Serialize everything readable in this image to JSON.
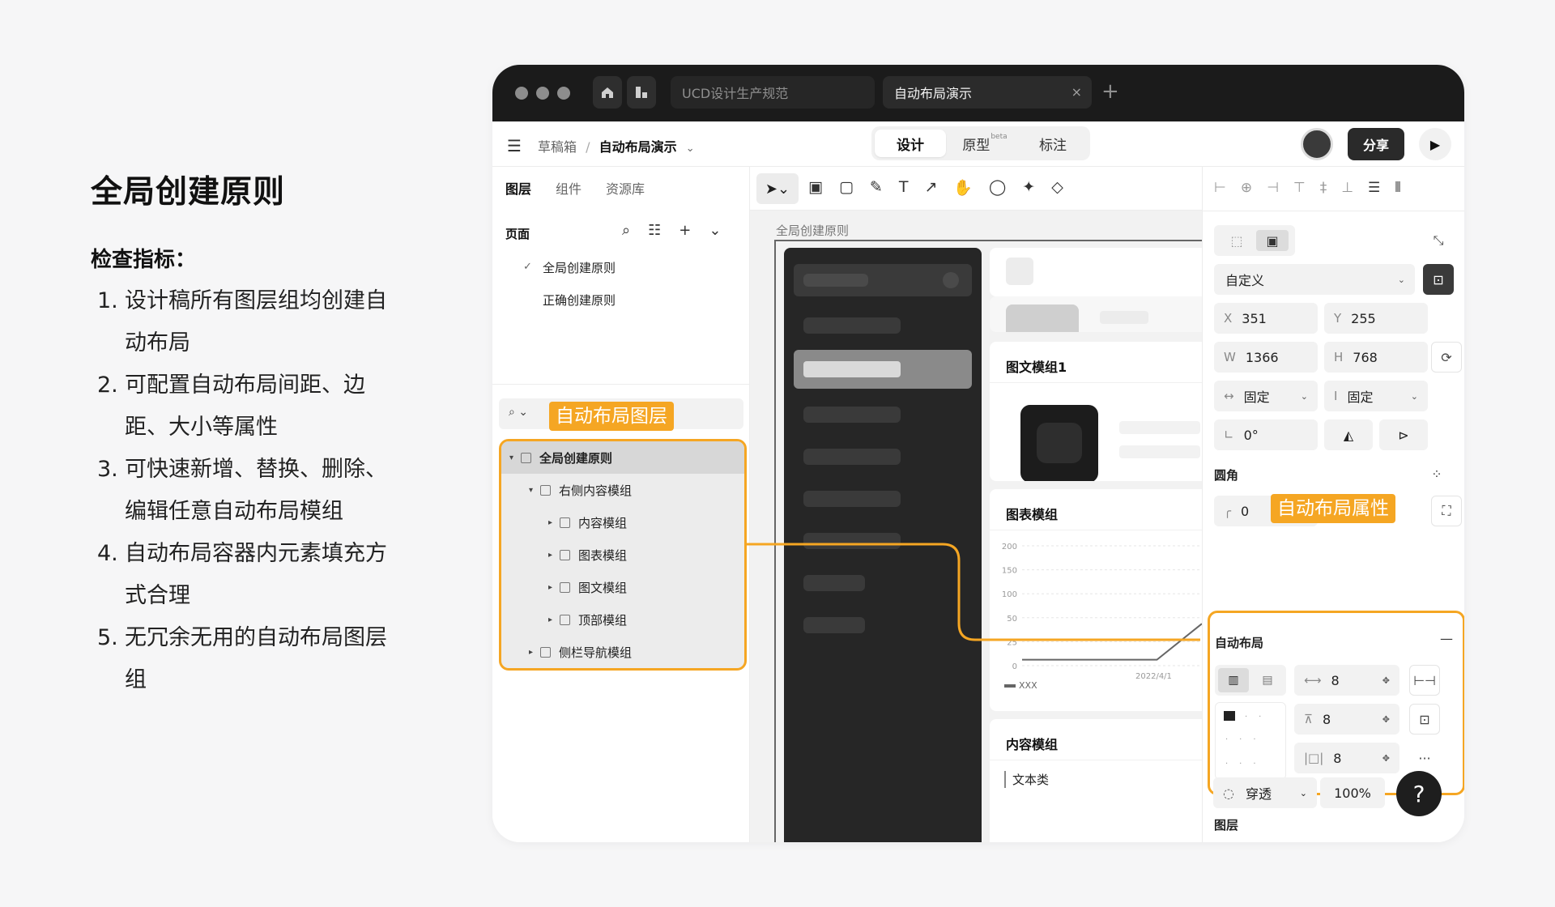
{
  "intro": {
    "title": "全局创建原则",
    "subtitle": "检查指标：",
    "items": [
      {
        "num": "1.",
        "text": "设计稿所有图层组均创建自动布局"
      },
      {
        "num": "2.",
        "text": "可配置自动布局间距、边距、大小等属性"
      },
      {
        "num": "3.",
        "text": "可快速新增、替换、删除、编辑任意自动布局模组"
      },
      {
        "num": "4.",
        "text": "自动布局容器内元素填充方式合理"
      },
      {
        "num": "5.",
        "text": "无冗余无用的自动布局图层组"
      }
    ]
  },
  "titlebar": {
    "tab_inactive": "UCD设计生产规范",
    "tab_active": "自动布局演示",
    "close": "×",
    "add": "+"
  },
  "toolbar": {
    "crumb_parent": "草稿箱",
    "crumb_sep": "/",
    "crumb_current": "自动布局演示",
    "crumb_chev": "⌄",
    "mode_design": "设计",
    "mode_proto": "原型",
    "beta": "beta",
    "mode_mark": "标注",
    "share": "分享",
    "play": "▶"
  },
  "left_panel": {
    "tabs": [
      "图层",
      "组件",
      "资源库"
    ],
    "pages_title": "页面",
    "pages": [
      "全局创建原则",
      "正确创建原则"
    ],
    "search_icon": "⌕ ⌄",
    "tag": "自动布局图层",
    "layers": [
      {
        "label": "全局创建原则",
        "arrow": "▾"
      },
      {
        "label": "右侧内容模组",
        "arrow": "▾"
      },
      {
        "label": "内容模组",
        "arrow": "▸"
      },
      {
        "label": "图表模组",
        "arrow": "▸"
      },
      {
        "label": "图文模组",
        "arrow": "▸"
      },
      {
        "label": "顶部模组",
        "arrow": "▸"
      },
      {
        "label": "侧栏导航模组",
        "arrow": "▸"
      }
    ]
  },
  "canvas": {
    "frame_label": "全局创建原则",
    "card_imgtext": "图文模组1",
    "card_chart": "图表模组",
    "card_content": "内容模组",
    "content_text": "文本类",
    "chart_ticks": [
      "200",
      "150",
      "100",
      "50",
      "25",
      "0"
    ],
    "chart_date": "2022/4/1",
    "chart_legend": "XXX"
  },
  "chart_data": {
    "type": "line",
    "x": [
      0,
      1,
      2,
      3,
      4
    ],
    "values": [
      10,
      10,
      10,
      10,
      70
    ],
    "ylim": [
      0,
      200
    ],
    "yticks": [
      "200",
      "150",
      "100",
      "50",
      "25",
      "0"
    ],
    "xlabel_tick": "2022/4/1",
    "legend": "XXX"
  },
  "right_panel": {
    "preset": "自定义",
    "x_label": "X",
    "x_value": "351",
    "y_label": "Y",
    "y_value": "255",
    "w_label": "W",
    "w_value": "1366",
    "h_label": "H",
    "h_value": "768",
    "w_mode": "固定",
    "h_mode": "固定",
    "rotation": "0°",
    "radius_title": "圆角",
    "radius_value": "0",
    "tag": "自动布局属性",
    "autolayout_title": "自动布局",
    "collapse": "—",
    "gap_h": "8",
    "gap_v": "8",
    "padding": "8",
    "more": "···",
    "layer_title": "图层",
    "blend": "穿透",
    "opacity": "100%",
    "help": "?"
  }
}
